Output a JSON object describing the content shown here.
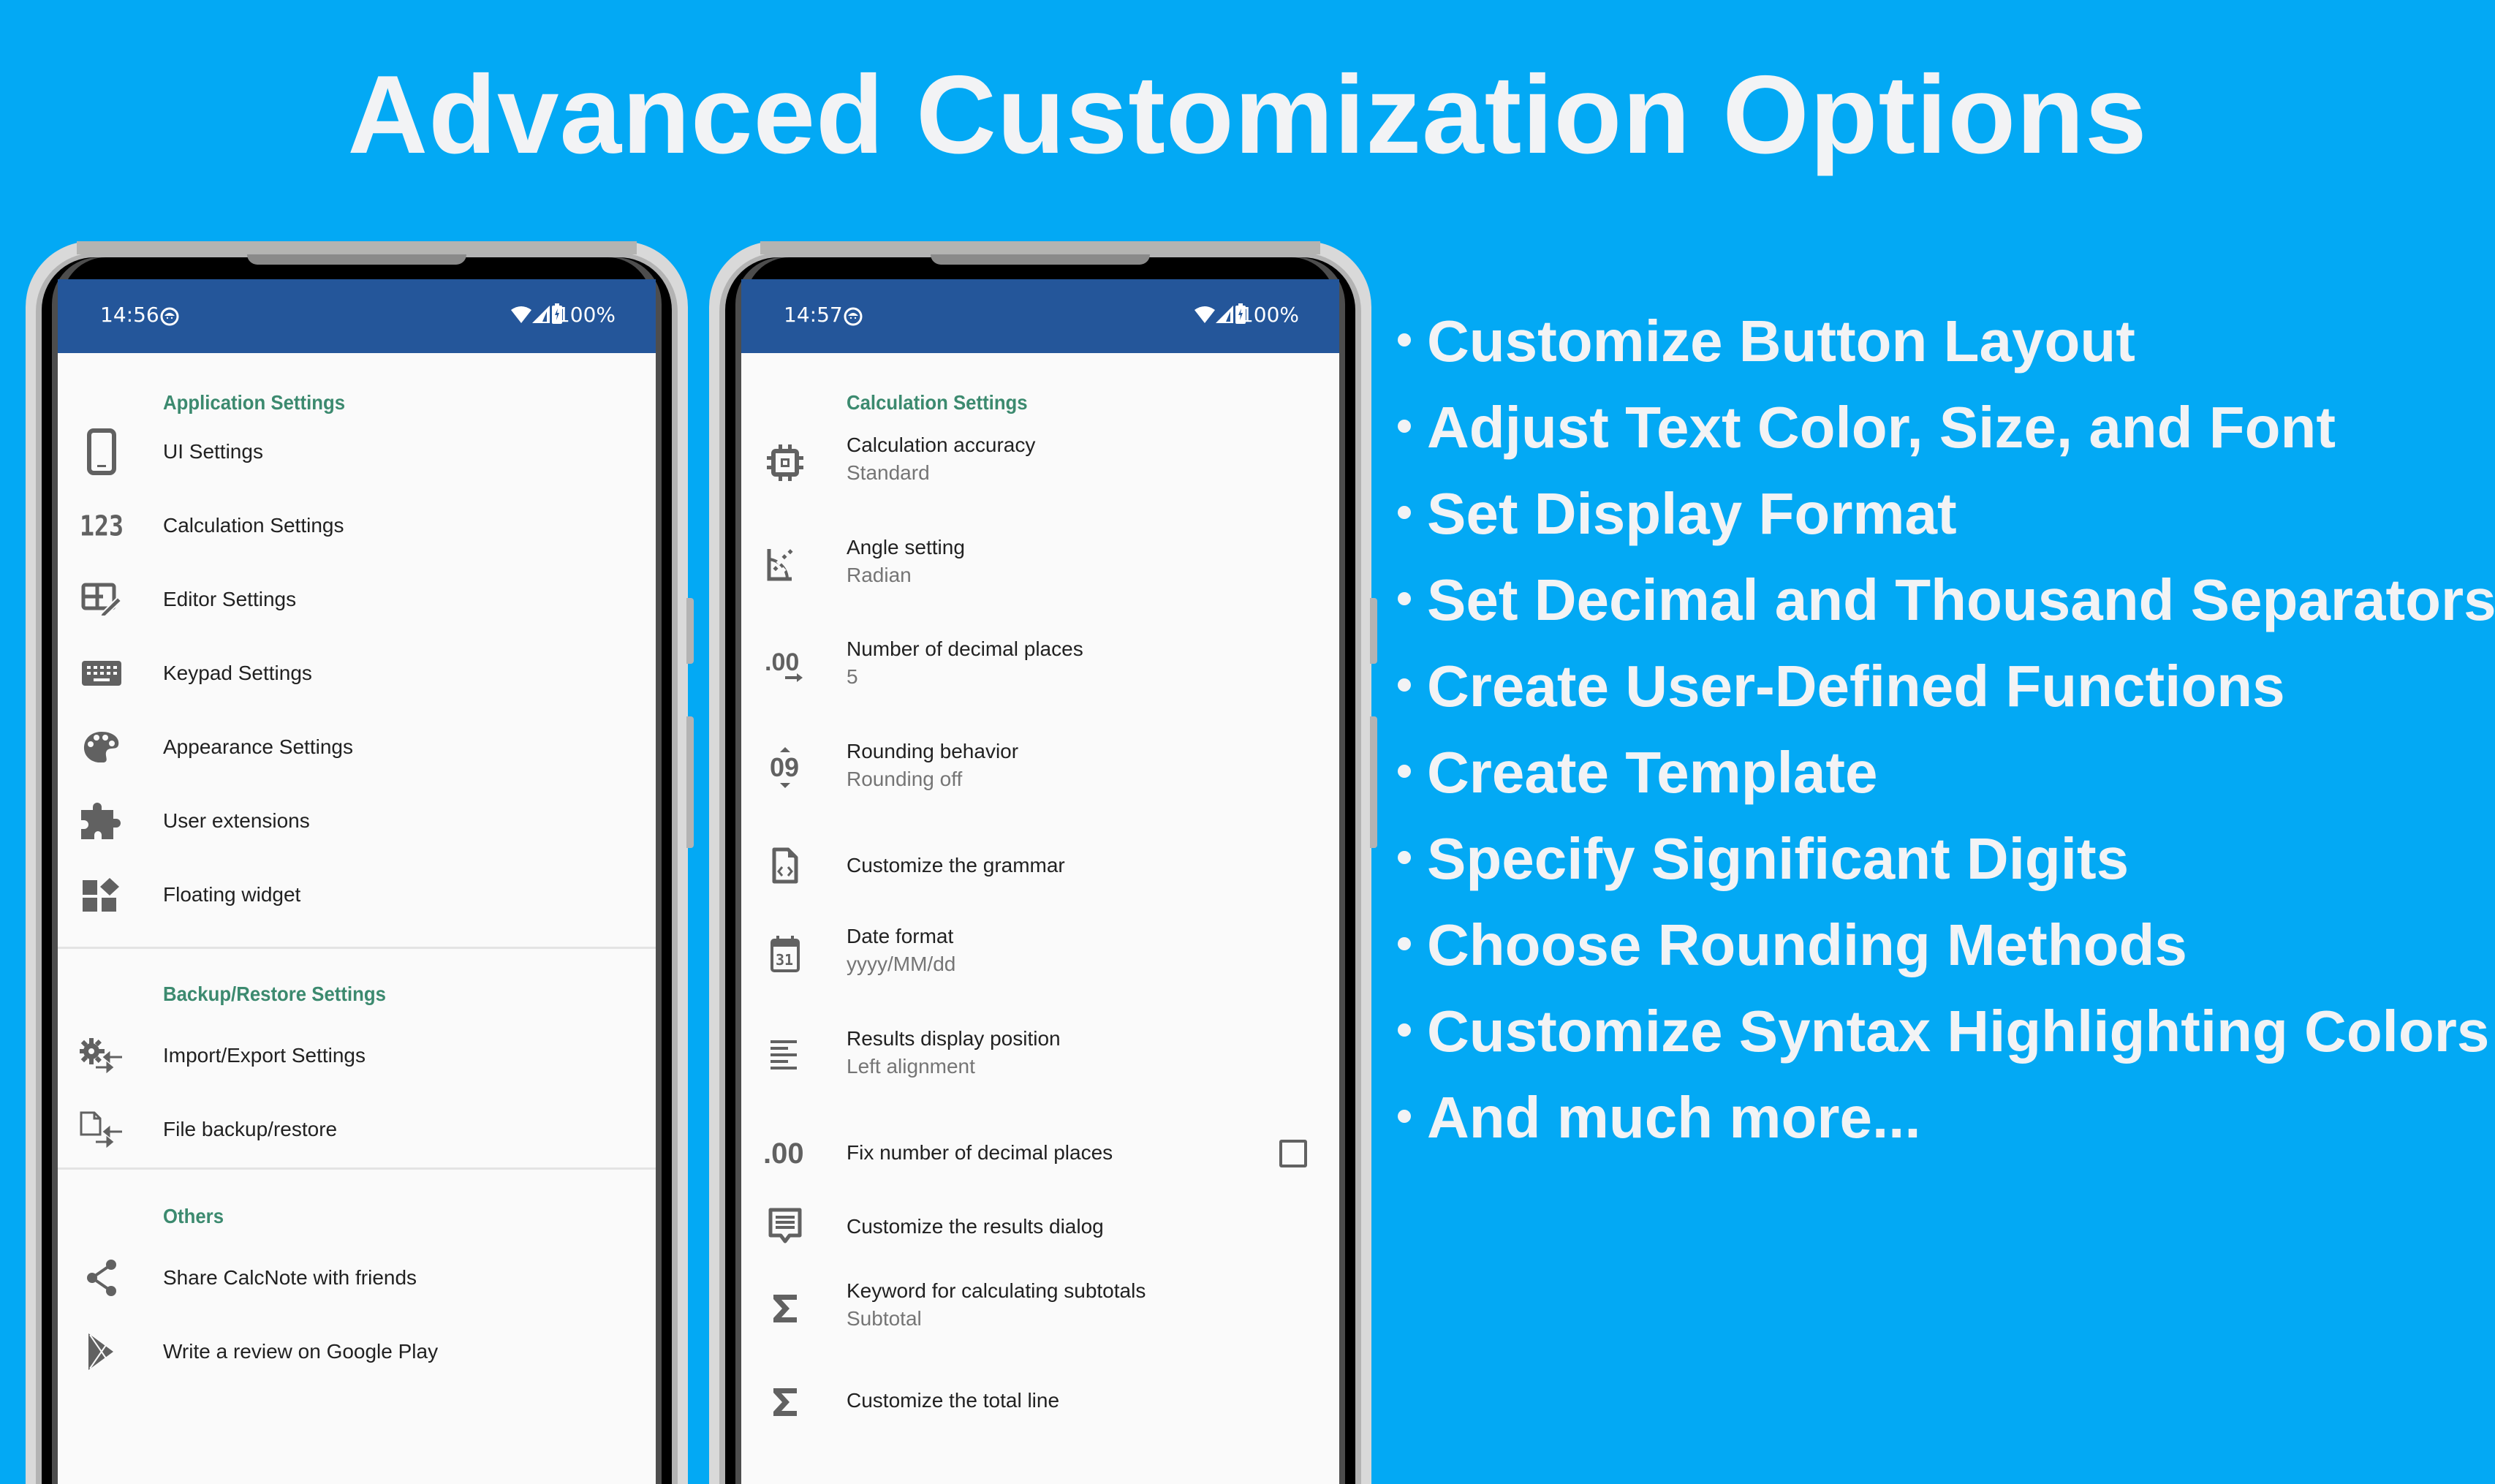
{
  "title": "Advanced Customization Options",
  "colors": {
    "background": "#03A9F4",
    "status_bar": "#24569A",
    "section_header": "#3C8A6F",
    "icon": "#616161",
    "text_primary": "#212121",
    "text_secondary": "#757575"
  },
  "phone1": {
    "status": {
      "time": "14:56",
      "battery": "100%"
    },
    "sections": [
      {
        "header": "Application Settings",
        "items": [
          {
            "icon": "phone-icon",
            "label": "UI Settings"
          },
          {
            "icon": "numbers-123-icon",
            "label": "Calculation Settings"
          },
          {
            "icon": "editor-edit-icon",
            "label": "Editor Settings"
          },
          {
            "icon": "keyboard-icon",
            "label": "Keypad Settings"
          },
          {
            "icon": "palette-icon",
            "label": "Appearance Settings"
          },
          {
            "icon": "extension-puzzle-icon",
            "label": "User extensions"
          },
          {
            "icon": "widgets-icon",
            "label": "Floating widget"
          }
        ]
      },
      {
        "header": "Backup/Restore Settings",
        "items": [
          {
            "icon": "settings-import-export-icon",
            "label": "Import/Export Settings"
          },
          {
            "icon": "file-import-export-icon",
            "label": "File backup/restore"
          }
        ]
      },
      {
        "header": "Others",
        "items": [
          {
            "icon": "share-icon",
            "label": "Share CalcNote with friends"
          },
          {
            "icon": "google-play-icon",
            "label": "Write a review on Google Play"
          }
        ]
      }
    ]
  },
  "phone2": {
    "status": {
      "time": "14:57",
      "battery": "100%"
    },
    "header": "Calculation Settings",
    "items": [
      {
        "icon": "chip-icon",
        "label": "Calculation accuracy",
        "value": "Standard"
      },
      {
        "icon": "angle-icon",
        "label": "Angle setting",
        "value": "Radian"
      },
      {
        "icon": "decimal-places-icon",
        "label": "Number of decimal places",
        "value": "5"
      },
      {
        "icon": "rounding-icon",
        "label": "Rounding behavior",
        "value": "Rounding off"
      },
      {
        "icon": "code-file-icon",
        "label": "Customize the grammar"
      },
      {
        "icon": "calendar-icon",
        "label": "Date format",
        "value": "yyyy/MM/dd"
      },
      {
        "icon": "align-left-icon",
        "label": "Results display position",
        "value": "Left alignment"
      },
      {
        "icon": "fixed-decimal-icon",
        "label": "Fix number of decimal places",
        "checked": false
      },
      {
        "icon": "dialog-icon",
        "label": "Customize the results dialog"
      },
      {
        "icon": "sigma-icon",
        "label": "Keyword for calculating subtotals",
        "value": "Subtotal"
      },
      {
        "icon": "sigma-icon",
        "label": "Customize the total line"
      }
    ]
  },
  "features": [
    "Customize Button Layout",
    "Adjust Text Color, Size, and Font",
    "Set Display Format",
    "Set Decimal and Thousand Separators",
    "Create User-Defined Functions",
    "Create Template",
    "Specify Significant Digits",
    "Choose Rounding Methods",
    "Customize Syntax Highlighting Colors",
    "And much more..."
  ]
}
